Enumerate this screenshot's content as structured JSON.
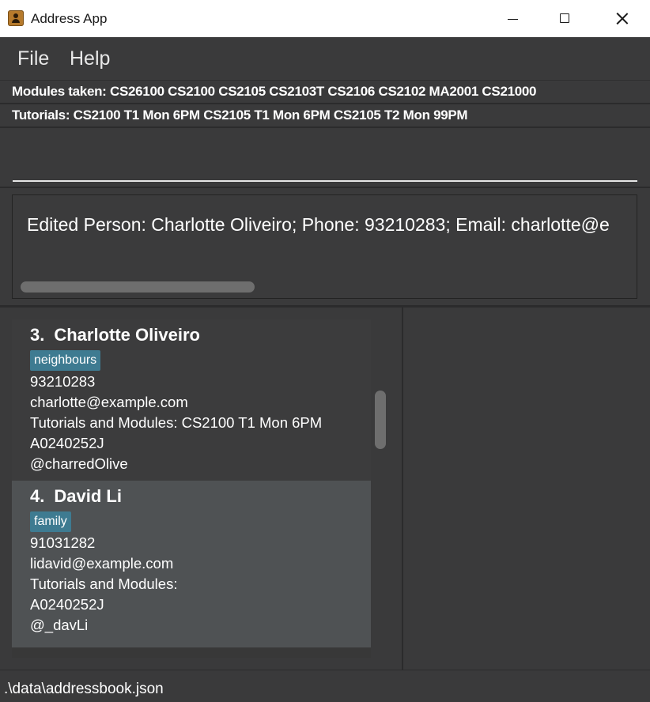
{
  "window": {
    "title": "Address App"
  },
  "menu": {
    "file_label": "File",
    "help_label": "Help"
  },
  "modules_bar": {
    "text": "Modules taken: CS26100 CS2100 CS2105 CS2103T CS2106 CS2102 MA2001 CS21000"
  },
  "tutorials_bar": {
    "text": "Tutorials: CS2100 T1 Mon 6PM  CS2105 T1 Mon 6PM  CS2105 T2 Mon 99PM"
  },
  "command_box": {
    "value": ""
  },
  "result": {
    "text": "Edited Person: Charlotte Oliveiro; Phone: 93210283; Email: charlotte@e"
  },
  "persons": [
    {
      "index": "3.",
      "name": "Charlotte Oliveiro",
      "tag": "neighbours",
      "phone": "93210283",
      "email": "charlotte@example.com",
      "tutorials": "Tutorials and Modules: CS2100 T1 Mon 6PM",
      "student_id": "A0240252J",
      "telegram": "@charredOlive"
    },
    {
      "index": "4.",
      "name": "David Li",
      "tag": "family",
      "phone": "91031282",
      "email": "lidavid@example.com",
      "tutorials": "Tutorials and Modules:",
      "student_id": "A0240252J",
      "telegram": "@_davLi"
    }
  ],
  "status_bar": {
    "path": ".\\data\\addressbook.json"
  },
  "colors": {
    "background": "#3a3a3b",
    "selected_card": "#4f5254",
    "tag": "#3e7b91"
  }
}
